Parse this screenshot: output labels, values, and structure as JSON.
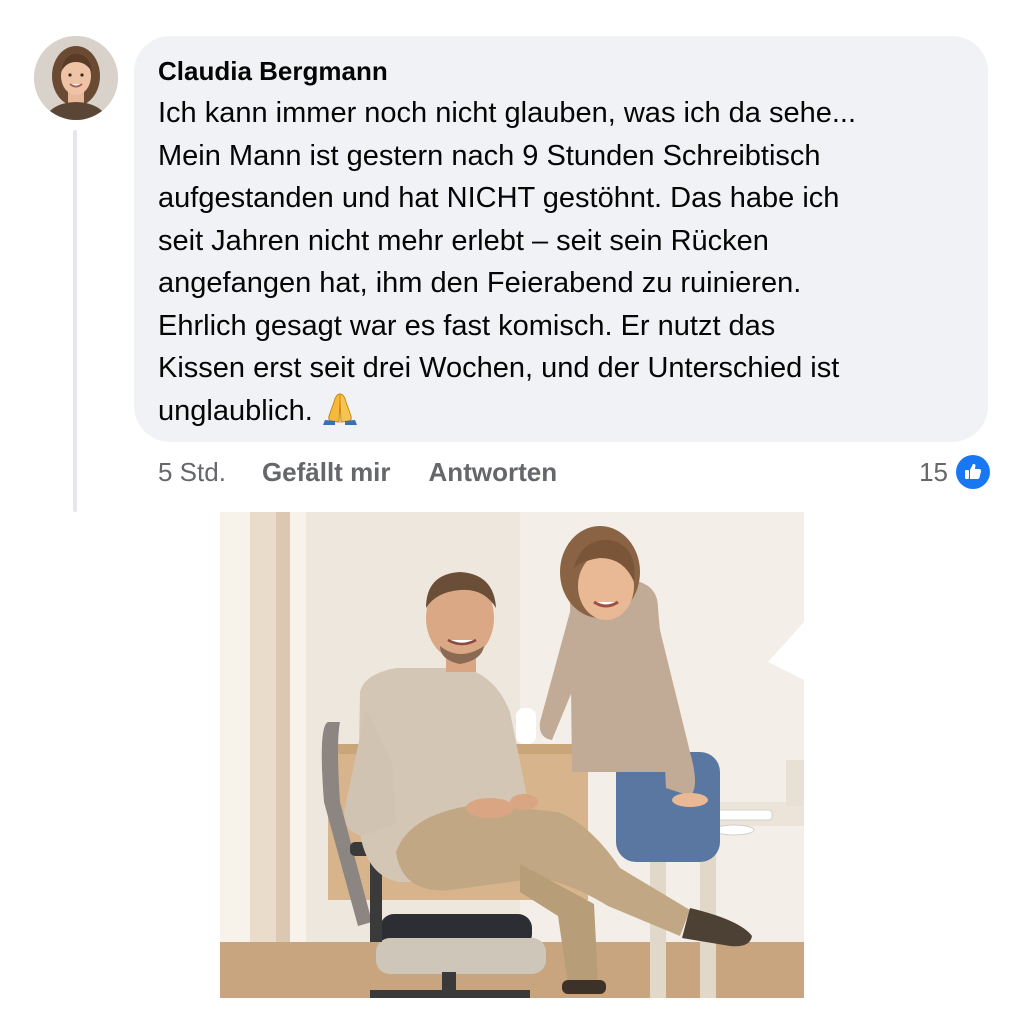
{
  "comment": {
    "author": "Claudia Bergmann",
    "text": "Ich kann immer noch nicht glauben, was ich da sehe...\nMein Mann ist gestern nach 9 Stunden Schreibtisch\naufgestanden und hat NICHT gestöhnt. Das habe ich\nseit Jahren nicht mehr erlebt – seit sein Rücken\nangefangen hat, ihm den Feierabend zu ruinieren.\nEhrlich gesagt war es fast komisch. Er nutzt das\nKissen erst seit drei Wochen, und der Unterschied ist\nunglaublich.",
    "emoji_icon": "folded-hands-emoji",
    "time": "5 Std.",
    "like_label": "Gefällt mir",
    "reply_label": "Antworten",
    "reaction_count": "15",
    "reaction_icon": "like-thumb-icon",
    "avatar_icon": "profile-photo-woman"
  },
  "attachment": {
    "kind": "photo",
    "subject_icon": "photo-man-on-office-chair-with-seat-cushion-and-woman-at-desk"
  },
  "colors": {
    "bubble": "#f0f2f5",
    "meta_text": "#65676b",
    "like_blue": "#1877f2",
    "thread_line": "#e4e6eb"
  }
}
